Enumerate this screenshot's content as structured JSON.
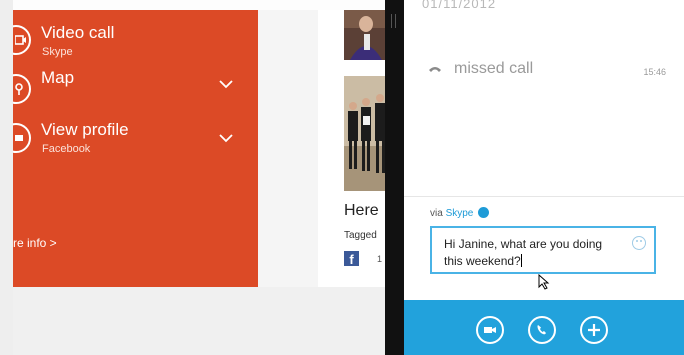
{
  "contact_panel": {
    "options": [
      {
        "title": "Video call",
        "subtitle": "Skype",
        "icon": "video-call-icon"
      },
      {
        "title": "Map",
        "subtitle": "",
        "icon": "map-icon"
      },
      {
        "title": "View profile",
        "subtitle": "Facebook",
        "icon": "profile-icon"
      }
    ],
    "more_info": "re info >"
  },
  "social_post": {
    "title": "Here",
    "tagged": "Tagged",
    "time": "1"
  },
  "chat": {
    "date": "01/11/2012",
    "missed_call": "missed call",
    "missed_time": "15:46",
    "via_prefix": "via",
    "via_service": "Skype",
    "message_text": "Hi Janine, what are you doing this weekend?"
  },
  "colors": {
    "accent_orange": "#dc4a26",
    "skype_blue": "#22a2dc"
  }
}
